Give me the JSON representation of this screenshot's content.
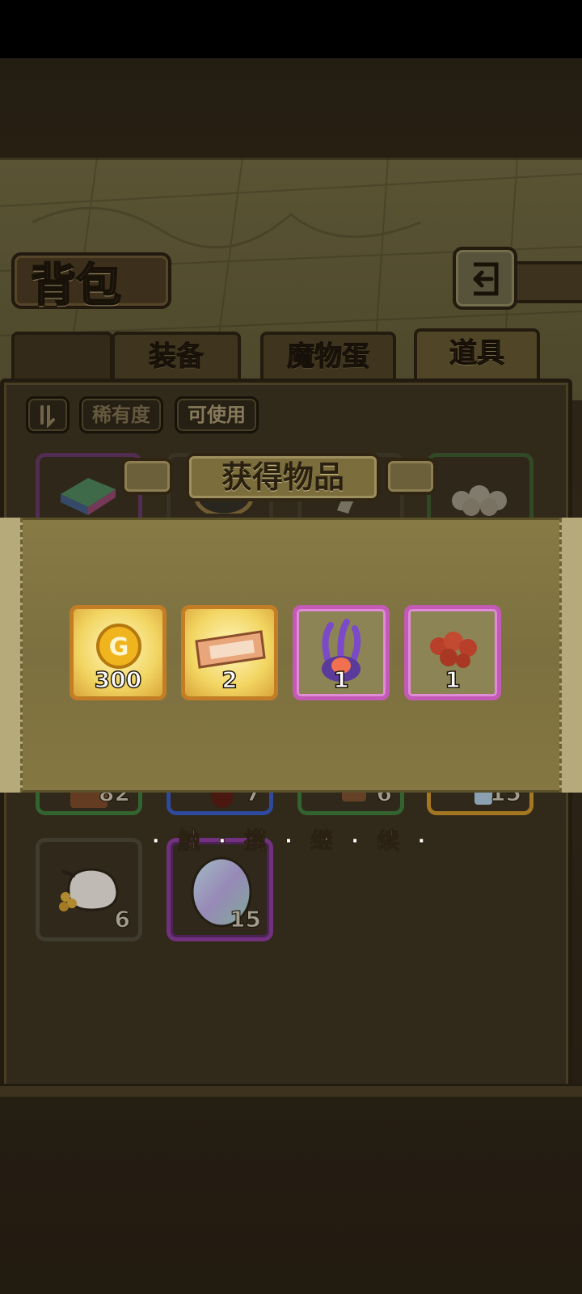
{
  "header": {
    "title": "背包"
  },
  "tabs": [
    {
      "label": "装备",
      "active": false
    },
    {
      "label": "魔物蛋",
      "active": false
    },
    {
      "label": "道具",
      "active": true
    }
  ],
  "filters": [
    {
      "label": "稀有度"
    },
    {
      "label": "可使用"
    }
  ],
  "inventory": [
    {
      "icon": "color-brick-icon",
      "count": ""
    },
    {
      "icon": "net-icon",
      "count": ""
    },
    {
      "icon": "horn-icon",
      "count": ""
    },
    {
      "icon": "eggs-pile-icon",
      "count": ""
    },
    {
      "icon": "book-icon",
      "count": "82"
    },
    {
      "icon": "potion-icon",
      "count": "7"
    },
    {
      "icon": "scroll-icon",
      "count": "6"
    },
    {
      "icon": "jar-icon",
      "count": "15"
    },
    {
      "icon": "coin-sack-icon",
      "count": "6"
    },
    {
      "icon": "rainbow-egg-icon",
      "count": "15"
    }
  ],
  "reward_popup": {
    "title": "获得物品",
    "items": [
      {
        "icon": "gold-coin-icon",
        "count": "300",
        "rarity": "gold"
      },
      {
        "icon": "ticket-icon",
        "count": "2",
        "rarity": "gold"
      },
      {
        "icon": "purple-tentacle-monster-icon",
        "count": "1",
        "rarity": "purple"
      },
      {
        "icon": "red-berries-icon",
        "count": "1",
        "rarity": "purple"
      }
    ],
    "coin_glyph": "G",
    "hint": "· 触 · 摸 · 继 · 续 ·"
  },
  "colors": {
    "gold_frame": "#c27d26",
    "purple_frame": "#c25ab6",
    "panel": "#3c3220"
  }
}
